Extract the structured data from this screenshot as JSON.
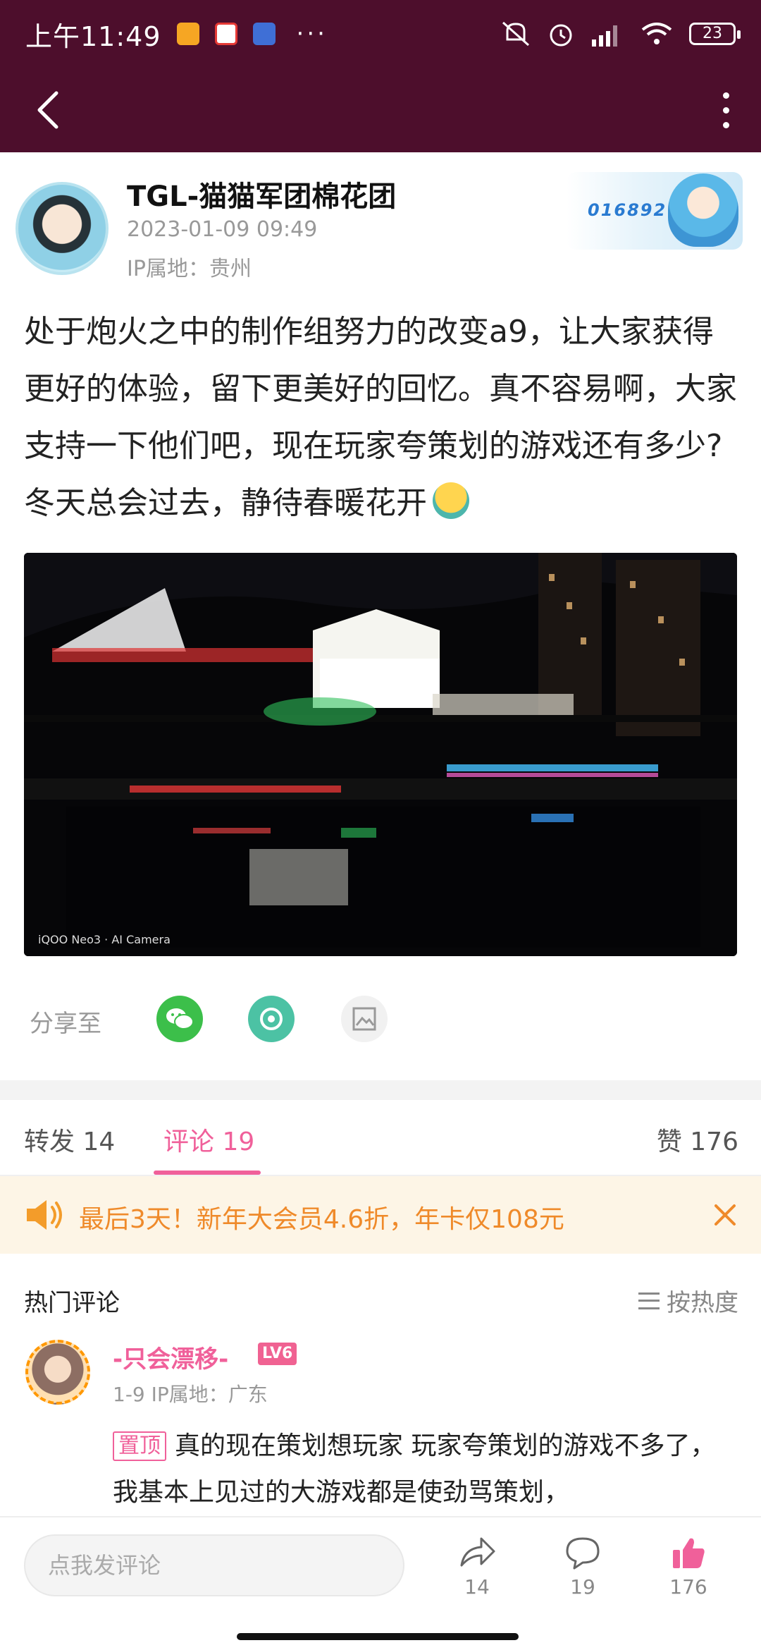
{
  "status_bar": {
    "time": "上午11:49",
    "dots": "···",
    "battery": "23",
    "icons": [
      "app-icon-1",
      "app-icon-2",
      "app-icon-3",
      "mute-icon",
      "alarm-icon",
      "signal-icon",
      "wifi-icon",
      "battery-icon"
    ]
  },
  "author": {
    "name": "TGL-猫猫军团棉花团",
    "time": "2023-01-09 09:49",
    "ip": "IP属地：贵州",
    "badge_number": "016892"
  },
  "post": {
    "text": "处于炮火之中的制作组努力的改变a9，让大家获得更好的体验，留下更美好的回忆。真不容易啊，大家支持一下他们吧，现在玩家夸策划的游戏还有多少?冬天总会过去，静待春暖花开",
    "photo_watermark": "iQOO Neo3 · AI Camera"
  },
  "share": {
    "label": "分享至",
    "targets": [
      "wechat-icon",
      "moments-icon",
      "image-share-icon"
    ]
  },
  "tabs": {
    "repost": "转发 14",
    "comments": "评论 19",
    "likes": "赞 176",
    "active": "comments"
  },
  "promo": {
    "text": "最后3天！新年大会员4.6折，年卡仅108元"
  },
  "comments_section": {
    "title": "热门评论",
    "sort_label": "按热度"
  },
  "comment": {
    "user": "-只会漂移-",
    "level": "LV6",
    "meta": "1-9  IP属地：广东",
    "pin_label": "置顶",
    "text": "真的现在策划想玩家 玩家夸策划的游戏不多了，我基本上见过的大游戏都是使劲骂策划，"
  },
  "bottom_bar": {
    "input_placeholder": "点我发评论",
    "share_count": "14",
    "comment_count": "19",
    "like_count": "176"
  },
  "colors": {
    "header": "#4d0e2c",
    "accent": "#f0609a",
    "promo_bg": "#fdf5e6",
    "promo_text": "#ef8a2a"
  }
}
